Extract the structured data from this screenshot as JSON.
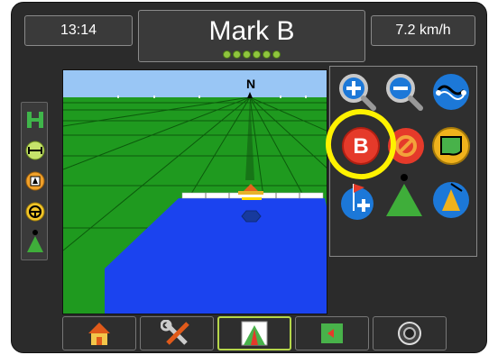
{
  "header": {
    "time": "13:14",
    "vehicle_name": "Mark B",
    "speed": "7.2 km/h",
    "gps_signal_leds": 6
  },
  "map_view": {
    "compass_label": "N",
    "colors": {
      "sky": "#99c6f5",
      "field": "#1f9a1f",
      "coverage": "#1b43ef",
      "boom": "#ffffff"
    }
  },
  "side_panel": {
    "icons": [
      "guidance-mode-icon",
      "swath-width-icon",
      "section-control-icon",
      "steering-icon",
      "vehicle-icon"
    ]
  },
  "guidance_panel": {
    "buttons": [
      "zoom-in-icon",
      "zoom-out-icon",
      "guideline-icon",
      "mark-b-icon",
      "cancel-icon",
      "boundary-icon",
      "add-flag-icon",
      "vehicle-view-icon",
      "nudge-icon"
    ],
    "highlighted": "mark-b-icon",
    "mark_b_label": "B",
    "highlight_color": "#fff200"
  },
  "bottom_nav": {
    "tabs": [
      "home-icon",
      "tools-icon",
      "guidance-view-icon",
      "map-icon",
      "camera-icon"
    ],
    "active": "guidance-view-icon"
  }
}
